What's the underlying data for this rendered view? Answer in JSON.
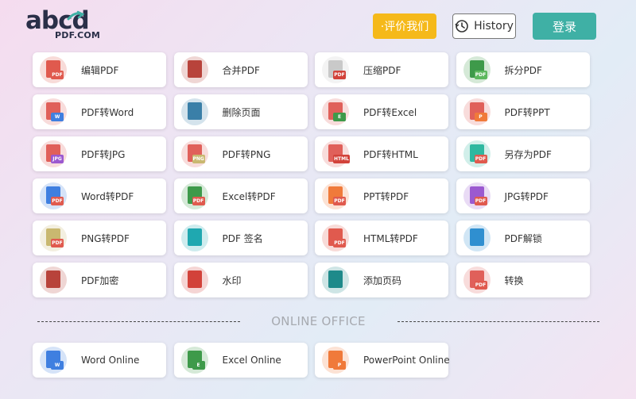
{
  "header": {
    "logo_text": "abcd",
    "logo_sub": "PDF.COM",
    "rate_label": "·评价我们",
    "history_label": "History",
    "login_label": "登录"
  },
  "tools": [
    {
      "label": "编辑PDF",
      "icon": "edit-pdf-icon",
      "color": "#e05a4e",
      "tag": "PDF",
      "tagColor": "#e05a4e"
    },
    {
      "label": "合并PDF",
      "icon": "merge-pdf-icon",
      "color": "#b8433b",
      "tag": "",
      "tagColor": "#b8433b"
    },
    {
      "label": "压缩PDF",
      "icon": "compress-pdf-icon",
      "color": "#c9c9c9",
      "tag": "PDF",
      "tagColor": "#d2423a"
    },
    {
      "label": "拆分PDF",
      "icon": "split-pdf-icon",
      "color": "#3e9a4a",
      "tag": "PDF",
      "tagColor": "#5db85e"
    },
    {
      "label": "PDF转Word",
      "icon": "pdf-to-word-icon",
      "color": "#e0605a",
      "tag": "W",
      "tagColor": "#3f7fe0"
    },
    {
      "label": "删除页面",
      "icon": "delete-pages-icon",
      "color": "#3a7fa8",
      "tag": "",
      "tagColor": "#3a7fa8"
    },
    {
      "label": "PDF转Excel",
      "icon": "pdf-to-excel-icon",
      "color": "#e0605a",
      "tag": "E",
      "tagColor": "#3e9a4a"
    },
    {
      "label": "PDF转PPT",
      "icon": "pdf-to-ppt-icon",
      "color": "#e0605a",
      "tag": "P",
      "tagColor": "#f07a3a"
    },
    {
      "label": "PDF转JPG",
      "icon": "pdf-to-jpg-icon",
      "color": "#e0605a",
      "tag": "JPG",
      "tagColor": "#9b59d0"
    },
    {
      "label": "PDF转PNG",
      "icon": "pdf-to-png-icon",
      "color": "#e0605a",
      "tag": "PNG",
      "tagColor": "#c9b870"
    },
    {
      "label": "PDF转HTML",
      "icon": "pdf-to-html-icon",
      "color": "#e0605a",
      "tag": "HTML",
      "tagColor": "#d2423a"
    },
    {
      "label": "另存为PDF",
      "icon": "save-as-pdf-icon",
      "color": "#2fb8a0",
      "tag": "PDF",
      "tagColor": "#e05a4e"
    },
    {
      "label": "Word转PDF",
      "icon": "word-to-pdf-icon",
      "color": "#3f7fe0",
      "tag": "PDF",
      "tagColor": "#e05a4e"
    },
    {
      "label": "Excel转PDF",
      "icon": "excel-to-pdf-icon",
      "color": "#3e9a4a",
      "tag": "PDF",
      "tagColor": "#e05a4e"
    },
    {
      "label": "PPT转PDF",
      "icon": "ppt-to-pdf-icon",
      "color": "#f07a3a",
      "tag": "PDF",
      "tagColor": "#e05a4e"
    },
    {
      "label": "JPG转PDF",
      "icon": "jpg-to-pdf-icon",
      "color": "#9b59d0",
      "tag": "PDF",
      "tagColor": "#e05a4e"
    },
    {
      "label": "PNG转PDF",
      "icon": "png-to-pdf-icon",
      "color": "#c9b870",
      "tag": "PDF",
      "tagColor": "#e05a4e"
    },
    {
      "label": "PDF 签名",
      "icon": "pdf-sign-icon",
      "color": "#1fa8b0",
      "tag": "",
      "tagColor": "#1fa8b0"
    },
    {
      "label": "HTML转PDF",
      "icon": "html-to-pdf-icon",
      "color": "#e05a4e",
      "tag": "PDF",
      "tagColor": "#e05a4e"
    },
    {
      "label": "PDF解锁",
      "icon": "pdf-unlock-icon",
      "color": "#2f8fd0",
      "tag": "",
      "tagColor": "#2f8fd0"
    },
    {
      "label": "PDF加密",
      "icon": "pdf-encrypt-icon",
      "color": "#b8433b",
      "tag": "",
      "tagColor": "#f0a030"
    },
    {
      "label": "水印",
      "icon": "watermark-icon",
      "color": "#d2423a",
      "tag": "",
      "tagColor": "#d2423a"
    },
    {
      "label": "添加页码",
      "icon": "add-page-numbers-icon",
      "color": "#1e8a8a",
      "tag": "",
      "tagColor": "#1e8a8a"
    },
    {
      "label": "转换",
      "icon": "convert-icon",
      "color": "#e0605a",
      "tag": "PDF",
      "tagColor": "#e05a4e"
    }
  ],
  "section": {
    "online_title": "ONLINE OFFICE"
  },
  "online": [
    {
      "label": "Word Online",
      "icon": "word-online-icon",
      "color": "#3f7fe0",
      "tag": "W",
      "tagColor": "#3f7fe0"
    },
    {
      "label": "Excel Online",
      "icon": "excel-online-icon",
      "color": "#3e9a4a",
      "tag": "E",
      "tagColor": "#3e9a4a"
    },
    {
      "label": "PowerPoint Online",
      "icon": "powerpoint-online-icon",
      "color": "#f07a3a",
      "tag": "P",
      "tagColor": "#f07a3a"
    }
  ]
}
